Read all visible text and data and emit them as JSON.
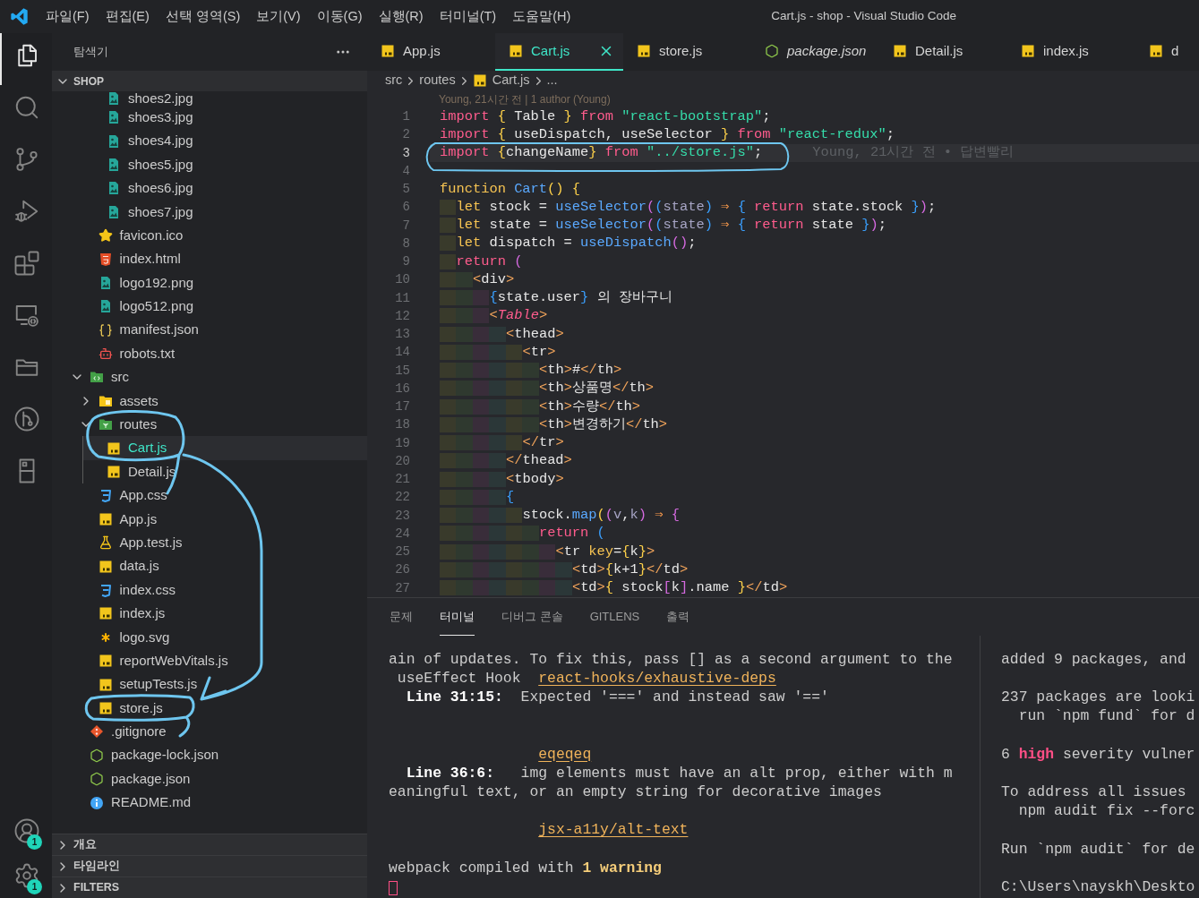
{
  "title_bar": {
    "menus": [
      "파일(F)",
      "편집(E)",
      "선택 영역(S)",
      "보기(V)",
      "이동(G)",
      "실행(R)",
      "터미널(T)",
      "도움말(H)"
    ],
    "title": "Cart.js - shop - Visual Studio Code"
  },
  "activity_bar": {
    "items": [
      {
        "kind": "explorer",
        "selected": true
      },
      {
        "kind": "search",
        "selected": false
      },
      {
        "kind": "scm",
        "selected": false
      },
      {
        "kind": "debug",
        "selected": false
      },
      {
        "kind": "extensions",
        "selected": false
      },
      {
        "kind": "remote",
        "selected": false
      },
      {
        "kind": "projects",
        "selected": false
      },
      {
        "kind": "gitlens",
        "selected": false
      },
      {
        "kind": "cabinet",
        "selected": false
      }
    ],
    "bottom": [
      {
        "kind": "accounts",
        "badge": "1"
      },
      {
        "kind": "settings",
        "badge": "1"
      }
    ]
  },
  "explorer": {
    "title": "탐색기",
    "section": {
      "label": "SHOP",
      "expanded": true
    },
    "tree": [
      {
        "children": [
          {
            "children": [
              {
                "label": "shoes2.jpg",
                "kind": "image",
                "selected": false
              },
              {
                "label": "shoes3.jpg",
                "kind": "image",
                "selected": false
              },
              {
                "label": "shoes4.jpg",
                "kind": "image",
                "selected": false
              },
              {
                "label": "shoes5.jpg",
                "kind": "image",
                "selected": false
              },
              {
                "label": "shoes6.jpg",
                "kind": "image",
                "selected": false
              },
              {
                "label": "shoes7.jpg",
                "kind": "image",
                "selected": false
              }
            ]
          },
          {
            "label": "favicon.ico",
            "kind": "star",
            "selected": false
          },
          {
            "label": "index.html",
            "kind": "html",
            "selected": false
          },
          {
            "label": "logo192.png",
            "kind": "image",
            "selected": false
          },
          {
            "label": "logo512.png",
            "kind": "image",
            "selected": false
          },
          {
            "label": "manifest.json",
            "kind": "braces",
            "selected": false
          },
          {
            "label": "robots.txt",
            "kind": "robot",
            "selected": false
          }
        ]
      },
      {
        "label": "src",
        "kind": "codefolder",
        "expanded": true,
        "selected": false,
        "children": [
          {
            "label": "assets",
            "kind": "folder",
            "expanded": false,
            "selected": false
          },
          {
            "label": "routes",
            "kind": "routefolder",
            "expanded": true,
            "selected": false,
            "children": [
              {
                "label": "Cart.js",
                "kind": "js",
                "selected": true
              },
              {
                "label": "Detail.js",
                "kind": "js",
                "selected": false
              }
            ]
          },
          {
            "label": "App.css",
            "kind": "css",
            "selected": false
          },
          {
            "label": "App.js",
            "kind": "js",
            "selected": false
          },
          {
            "label": "App.test.js",
            "kind": "test",
            "selected": false
          },
          {
            "label": "data.js",
            "kind": "js",
            "selected": false
          },
          {
            "label": "index.css",
            "kind": "css",
            "selected": false
          },
          {
            "label": "index.js",
            "kind": "js",
            "selected": false
          },
          {
            "label": "logo.svg",
            "kind": "svg",
            "selected": false
          },
          {
            "label": "reportWebVitals.js",
            "kind": "js",
            "selected": false
          },
          {
            "label": "setupTests.js",
            "kind": "js",
            "selected": false
          },
          {
            "label": "store.js",
            "kind": "js",
            "selected": false
          }
        ]
      },
      {
        "label": ".gitignore",
        "kind": "git",
        "selected": false
      },
      {
        "label": "package-lock.json",
        "kind": "node",
        "selected": false
      },
      {
        "label": "package.json",
        "kind": "node",
        "selected": false
      },
      {
        "label": "README.md",
        "kind": "info",
        "selected": false
      }
    ],
    "panels": [
      {
        "label": "개요",
        "expanded": false
      },
      {
        "label": "타임라인",
        "expanded": false
      },
      {
        "label": "FILTERS",
        "expanded": false
      }
    ]
  },
  "editor": {
    "tabs": [
      {
        "label": "App.js",
        "kind": "js",
        "selected": false,
        "preview": false
      },
      {
        "label": "Cart.js",
        "kind": "js",
        "selected": true,
        "preview": false
      },
      {
        "label": "store.js",
        "kind": "js",
        "selected": false,
        "preview": false
      },
      {
        "label": "package.json",
        "kind": "node",
        "selected": false,
        "preview": true
      },
      {
        "label": "Detail.js",
        "kind": "js",
        "selected": false,
        "preview": false
      },
      {
        "label": "index.js",
        "kind": "js",
        "selected": false,
        "preview": false
      },
      {
        "label": "d",
        "kind": "js",
        "selected": false,
        "preview": false
      }
    ],
    "breadcrumb": [
      {
        "label": "src",
        "kind": "folder"
      },
      {
        "label": "routes",
        "kind": "folder"
      },
      {
        "label": "Cart.js",
        "kind": "js"
      },
      {
        "label": "...",
        "kind": "symbol"
      }
    ],
    "codelens": "Young, 21시간 전 | 1 author (Young)",
    "lines": [
      {
        "number": "1",
        "current": false,
        "tokens": [
          {
            "text": "import ",
            "kind": "keyword"
          },
          {
            "text": "{",
            "kind": "bracket"
          },
          {
            "text": " Table ",
            "kind": "plain"
          },
          {
            "text": "}",
            "kind": "bracket"
          },
          {
            "text": " from ",
            "kind": "keyword"
          },
          {
            "text": "\"react-bootstrap\"",
            "kind": "string"
          },
          {
            "text": ";",
            "kind": "plain"
          }
        ]
      },
      {
        "number": "2",
        "current": false,
        "tokens": [
          {
            "text": "import ",
            "kind": "keyword"
          },
          {
            "text": "{",
            "kind": "bracket"
          },
          {
            "text": " useDispatch, useSelector ",
            "kind": "plain"
          },
          {
            "text": "}",
            "kind": "bracket"
          },
          {
            "text": " from ",
            "kind": "keyword"
          },
          {
            "text": "\"react-redux\"",
            "kind": "string"
          },
          {
            "text": ";",
            "kind": "plain"
          }
        ]
      },
      {
        "number": "3",
        "current": true,
        "blame": "Young, 21시간 전 • 답변빨리",
        "tokens": [
          {
            "text": "import ",
            "kind": "keyword"
          },
          {
            "text": "{",
            "kind": "bracket"
          },
          {
            "text": "changeName",
            "kind": "plain"
          },
          {
            "text": "}",
            "kind": "bracket"
          },
          {
            "text": " from ",
            "kind": "keyword"
          },
          {
            "text": "\"../store.js\"",
            "kind": "string"
          },
          {
            "text": ";",
            "kind": "plain"
          }
        ]
      },
      {
        "number": "4",
        "current": false
      },
      {
        "number": "5",
        "current": false,
        "tokens": [
          {
            "text": "function ",
            "kind": "storage"
          },
          {
            "text": "Cart",
            "kind": "function"
          },
          {
            "text": "()",
            "kind": "bracket"
          },
          {
            "text": " {",
            "kind": "bracket"
          }
        ]
      },
      {
        "number": "6",
        "current": false,
        "tokens": [
          {
            "text": "  let ",
            "kind": "storage"
          },
          {
            "text": "stock = ",
            "kind": "plain"
          },
          {
            "text": "useSelector",
            "kind": "function"
          },
          {
            "text": "(",
            "kind": "bracket2"
          },
          {
            "text": "(",
            "kind": "bracket3"
          },
          {
            "text": "state",
            "kind": "param"
          },
          {
            "text": ")",
            "kind": "bracket3"
          },
          {
            "text": " ⇒ ",
            "kind": "arrow"
          },
          {
            "text": "{",
            "kind": "bracket3"
          },
          {
            "text": " return ",
            "kind": "keyword"
          },
          {
            "text": "state.stock ",
            "kind": "plain"
          },
          {
            "text": "}",
            "kind": "bracket3"
          },
          {
            "text": ")",
            "kind": "bracket2"
          },
          {
            "text": ";",
            "kind": "plain"
          }
        ]
      },
      {
        "number": "7",
        "current": false,
        "tokens": [
          {
            "text": "  let ",
            "kind": "storage"
          },
          {
            "text": "state = ",
            "kind": "plain"
          },
          {
            "text": "useSelector",
            "kind": "function"
          },
          {
            "text": "(",
            "kind": "bracket2"
          },
          {
            "text": "(",
            "kind": "bracket3"
          },
          {
            "text": "state",
            "kind": "param"
          },
          {
            "text": ")",
            "kind": "bracket3"
          },
          {
            "text": " ⇒ ",
            "kind": "arrow"
          },
          {
            "text": "{",
            "kind": "bracket3"
          },
          {
            "text": " return ",
            "kind": "keyword"
          },
          {
            "text": "state ",
            "kind": "plain"
          },
          {
            "text": "}",
            "kind": "bracket3"
          },
          {
            "text": ")",
            "kind": "bracket2"
          },
          {
            "text": ";",
            "kind": "plain"
          }
        ]
      },
      {
        "number": "8",
        "current": false,
        "tokens": [
          {
            "text": "  let ",
            "kind": "storage"
          },
          {
            "text": "dispatch = ",
            "kind": "plain"
          },
          {
            "text": "useDispatch",
            "kind": "function"
          },
          {
            "text": "()",
            "kind": "bracket2"
          },
          {
            "text": ";",
            "kind": "plain"
          }
        ]
      },
      {
        "number": "9",
        "current": false,
        "tokens": [
          {
            "text": "  return ",
            "kind": "keyword"
          },
          {
            "text": "(",
            "kind": "bracket2"
          }
        ]
      },
      {
        "number": "10",
        "current": false,
        "tokens": [
          {
            "text": "    <",
            "kind": "tag"
          },
          {
            "text": "div",
            "kind": "plain"
          },
          {
            "text": ">",
            "kind": "tag"
          }
        ]
      },
      {
        "number": "11",
        "current": false,
        "tokens": [
          {
            "text": "      {",
            "kind": "bracket3"
          },
          {
            "text": "state.user",
            "kind": "plain"
          },
          {
            "text": "}",
            "kind": "bracket3"
          },
          {
            "text": " 의 장바구니",
            "kind": "plain"
          }
        ]
      },
      {
        "number": "12",
        "current": false,
        "tokens": [
          {
            "text": "      <",
            "kind": "tag"
          },
          {
            "text": "Table",
            "kind": "component"
          },
          {
            "text": ">",
            "kind": "tag"
          }
        ]
      },
      {
        "number": "13",
        "current": false,
        "tokens": [
          {
            "text": "        <",
            "kind": "tag"
          },
          {
            "text": "thead",
            "kind": "plain"
          },
          {
            "text": ">",
            "kind": "tag"
          }
        ]
      },
      {
        "number": "14",
        "current": false,
        "tokens": [
          {
            "text": "          <",
            "kind": "tag"
          },
          {
            "text": "tr",
            "kind": "plain"
          },
          {
            "text": ">",
            "kind": "tag"
          }
        ]
      },
      {
        "number": "15",
        "current": false,
        "tokens": [
          {
            "text": "            <",
            "kind": "tag"
          },
          {
            "text": "th",
            "kind": "plain"
          },
          {
            "text": ">",
            "kind": "tag"
          },
          {
            "text": "#",
            "kind": "plain"
          },
          {
            "text": "</",
            "kind": "tag"
          },
          {
            "text": "th",
            "kind": "plain"
          },
          {
            "text": ">",
            "kind": "tag"
          }
        ]
      },
      {
        "number": "16",
        "current": false,
        "tokens": [
          {
            "text": "            <",
            "kind": "tag"
          },
          {
            "text": "th",
            "kind": "plain"
          },
          {
            "text": ">",
            "kind": "tag"
          },
          {
            "text": "상품명",
            "kind": "plain"
          },
          {
            "text": "</",
            "kind": "tag"
          },
          {
            "text": "th",
            "kind": "plain"
          },
          {
            "text": ">",
            "kind": "tag"
          }
        ]
      },
      {
        "number": "17",
        "current": false,
        "tokens": [
          {
            "text": "            <",
            "kind": "tag"
          },
          {
            "text": "th",
            "kind": "plain"
          },
          {
            "text": ">",
            "kind": "tag"
          },
          {
            "text": "수량",
            "kind": "plain"
          },
          {
            "text": "</",
            "kind": "tag"
          },
          {
            "text": "th",
            "kind": "plain"
          },
          {
            "text": ">",
            "kind": "tag"
          }
        ]
      },
      {
        "number": "18",
        "current": false,
        "tokens": [
          {
            "text": "            <",
            "kind": "tag"
          },
          {
            "text": "th",
            "kind": "plain"
          },
          {
            "text": ">",
            "kind": "tag"
          },
          {
            "text": "변경하기",
            "kind": "plain"
          },
          {
            "text": "</",
            "kind": "tag"
          },
          {
            "text": "th",
            "kind": "plain"
          },
          {
            "text": ">",
            "kind": "tag"
          }
        ]
      },
      {
        "number": "19",
        "current": false,
        "tokens": [
          {
            "text": "          </",
            "kind": "tag"
          },
          {
            "text": "tr",
            "kind": "plain"
          },
          {
            "text": ">",
            "kind": "tag"
          }
        ]
      },
      {
        "number": "20",
        "current": false,
        "tokens": [
          {
            "text": "        </",
            "kind": "tag"
          },
          {
            "text": "thead",
            "kind": "plain"
          },
          {
            "text": ">",
            "kind": "tag"
          }
        ]
      },
      {
        "number": "21",
        "current": false,
        "tokens": [
          {
            "text": "        <",
            "kind": "tag"
          },
          {
            "text": "tbody",
            "kind": "plain"
          },
          {
            "text": ">",
            "kind": "tag"
          }
        ]
      },
      {
        "number": "22",
        "current": false,
        "tokens": [
          {
            "text": "        {",
            "kind": "bracket3"
          }
        ]
      },
      {
        "number": "23",
        "current": false,
        "tokens": [
          {
            "text": "          stock.",
            "kind": "plain"
          },
          {
            "text": "map",
            "kind": "function"
          },
          {
            "text": "(",
            "kind": "bracket"
          },
          {
            "text": "(",
            "kind": "bracket2"
          },
          {
            "text": "v",
            "kind": "param"
          },
          {
            "text": ",",
            "kind": "plain"
          },
          {
            "text": "k",
            "kind": "param"
          },
          {
            "text": ")",
            "kind": "bracket2"
          },
          {
            "text": " ⇒ ",
            "kind": "arrow"
          },
          {
            "text": "{",
            "kind": "bracket2"
          }
        ]
      },
      {
        "number": "24",
        "current": false,
        "tokens": [
          {
            "text": "            return ",
            "kind": "keyword"
          },
          {
            "text": "(",
            "kind": "bracket3"
          }
        ]
      },
      {
        "number": "25",
        "current": false,
        "tokens": [
          {
            "text": "              <",
            "kind": "tag"
          },
          {
            "text": "tr ",
            "kind": "plain"
          },
          {
            "text": "key",
            "kind": "attribute"
          },
          {
            "text": "=",
            "kind": "plain"
          },
          {
            "text": "{",
            "kind": "bracket"
          },
          {
            "text": "k",
            "kind": "plain"
          },
          {
            "text": "}",
            "kind": "bracket"
          },
          {
            "text": ">",
            "kind": "tag"
          }
        ]
      },
      {
        "number": "26",
        "current": false,
        "tokens": [
          {
            "text": "                <",
            "kind": "tag"
          },
          {
            "text": "td",
            "kind": "plain"
          },
          {
            "text": ">",
            "kind": "tag"
          },
          {
            "text": "{",
            "kind": "bracket"
          },
          {
            "text": "k+1",
            "kind": "plain"
          },
          {
            "text": "}",
            "kind": "bracket"
          },
          {
            "text": "</",
            "kind": "tag"
          },
          {
            "text": "td",
            "kind": "plain"
          },
          {
            "text": ">",
            "kind": "tag"
          }
        ]
      },
      {
        "number": "27",
        "current": false,
        "tokens": [
          {
            "text": "                <",
            "kind": "tag"
          },
          {
            "text": "td",
            "kind": "plain"
          },
          {
            "text": ">",
            "kind": "tag"
          },
          {
            "text": "{",
            "kind": "bracket"
          },
          {
            "text": " stock",
            "kind": "plain"
          },
          {
            "text": "[",
            "kind": "bracket2"
          },
          {
            "text": "k",
            "kind": "plain"
          },
          {
            "text": "]",
            "kind": "bracket2"
          },
          {
            "text": ".name ",
            "kind": "plain"
          },
          {
            "text": "}",
            "kind": "bracket"
          },
          {
            "text": "</",
            "kind": "tag"
          },
          {
            "text": "td",
            "kind": "plain"
          },
          {
            "text": ">",
            "kind": "tag"
          }
        ]
      }
    ]
  },
  "panel": {
    "tabs": [
      {
        "label": "문제",
        "selected": false
      },
      {
        "label": "터미널",
        "selected": true
      },
      {
        "label": "디버그 콘솔",
        "selected": false
      },
      {
        "label": "GITLENS",
        "selected": false
      },
      {
        "label": "출력",
        "selected": false
      }
    ],
    "terminals": [
      {
        "lines": [
          {
            "kind": "text",
            "segments": [
              {
                "text": "ain of updates. To fix this, pass [] as a second argument to the",
                "kind": "plain"
              }
            ]
          },
          {
            "kind": "text",
            "segments": [
              {
                "text": " useEffect Hook  ",
                "kind": "plain"
              },
              {
                "text": "react-hooks/exhaustive-deps",
                "kind": "link"
              }
            ]
          },
          {
            "kind": "text",
            "segments": [
              {
                "text": "  Line 31:15:",
                "kind": "bold"
              },
              {
                "text": "  Expected '===' and instead saw '=='",
                "kind": "plain"
              }
            ]
          },
          {
            "kind": "blank"
          },
          {
            "kind": "blank"
          },
          {
            "kind": "text",
            "segments": [
              {
                "text": "                 eqeqeq",
                "kind": "link"
              }
            ]
          },
          {
            "kind": "text",
            "segments": [
              {
                "text": "  Line 36:6:",
                "kind": "bold"
              },
              {
                "text": "   img elements must have an alt prop, either with m",
                "kind": "plain"
              }
            ]
          },
          {
            "kind": "text",
            "segments": [
              {
                "text": "eaningful text, or an empty string for decorative images",
                "kind": "plain"
              }
            ]
          },
          {
            "kind": "blank"
          },
          {
            "kind": "text",
            "segments": [
              {
                "text": "                 jsx-a11y/alt-text",
                "kind": "link"
              }
            ]
          },
          {
            "kind": "blank"
          },
          {
            "kind": "text",
            "segments": [
              {
                "text": "webpack compiled with ",
                "kind": "plain"
              },
              {
                "text": "1 warning",
                "kind": "warning"
              }
            ]
          },
          {
            "kind": "cursor"
          }
        ]
      },
      {
        "lines": [
          {
            "kind": "text",
            "segments": [
              {
                "text": "added 9 packages, and",
                "kind": "plain"
              }
            ]
          },
          {
            "kind": "blank"
          },
          {
            "kind": "text",
            "segments": [
              {
                "text": "237 packages are looki",
                "kind": "plain"
              }
            ]
          },
          {
            "kind": "text",
            "segments": [
              {
                "text": "  run `npm fund` for d",
                "kind": "plain"
              }
            ]
          },
          {
            "kind": "blank"
          },
          {
            "kind": "text",
            "segments": [
              {
                "text": "6 ",
                "kind": "plain"
              },
              {
                "text": "high",
                "kind": "danger"
              },
              {
                "text": " severity vulner",
                "kind": "plain"
              }
            ]
          },
          {
            "kind": "blank"
          },
          {
            "kind": "text",
            "segments": [
              {
                "text": "To address all issues",
                "kind": "plain"
              }
            ]
          },
          {
            "kind": "text",
            "segments": [
              {
                "text": "  npm audit fix --forc",
                "kind": "plain"
              }
            ]
          },
          {
            "kind": "blank"
          },
          {
            "kind": "text",
            "segments": [
              {
                "text": "Run `npm audit` for de",
                "kind": "plain"
              }
            ]
          },
          {
            "kind": "blank"
          },
          {
            "kind": "text",
            "segments": [
              {
                "text": "C:\\Users\\nayskh\\Deskto",
                "kind": "plain"
              }
            ]
          }
        ]
      }
    ]
  }
}
